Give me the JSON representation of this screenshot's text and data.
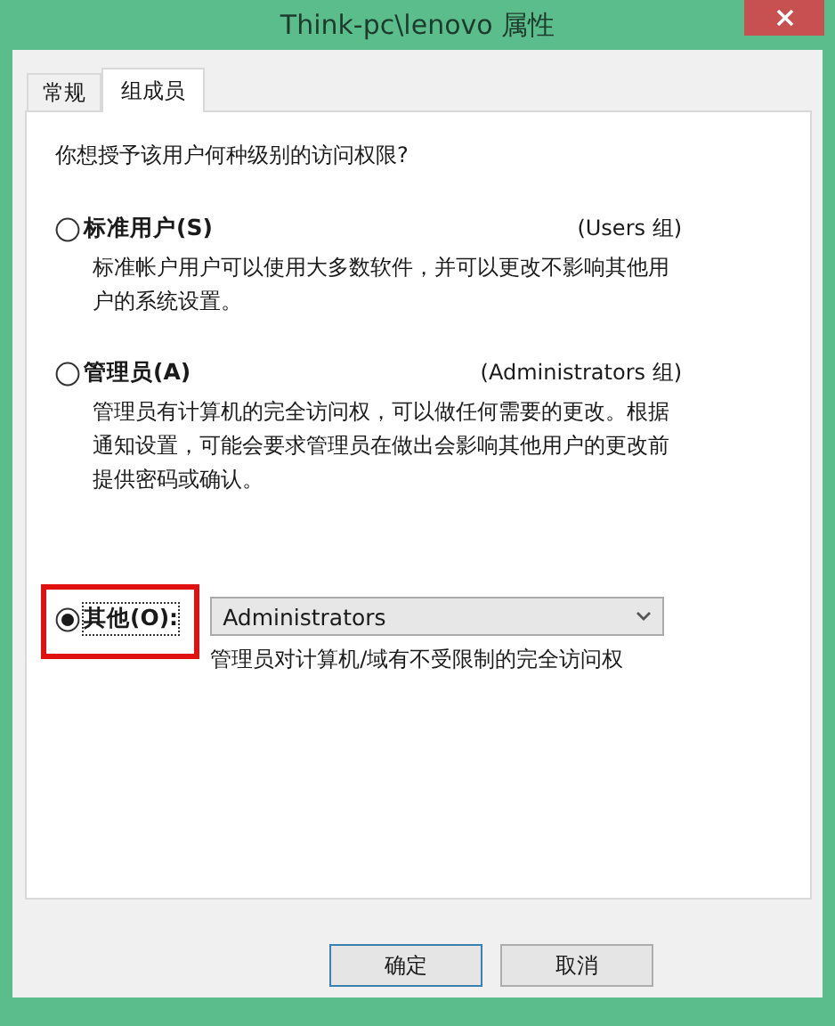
{
  "window": {
    "title": "Think-pc\\lenovo 属性"
  },
  "tabs": [
    {
      "label": "常规",
      "selected": false
    },
    {
      "label": "组成员",
      "selected": true
    }
  ],
  "question": "你想授予该用户何种级别的访问权限?",
  "options": [
    {
      "kind": "preset",
      "label": "标准用户(S)",
      "group": "(Users 组)",
      "description": "标准帐户用户可以使用大多数软件，并可以更改不影响其他用户的系统设置。",
      "selected": false,
      "highlighted": false
    },
    {
      "kind": "preset",
      "label": "管理员(A)",
      "group": "(Administrators 组)",
      "description": "管理员有计算机的完全访问权，可以做任何需要的更改。根据通知设置，可能会要求管理员在做出会影响其他用户的更改前提供密码或确认。",
      "selected": false,
      "highlighted": false
    },
    {
      "kind": "custom",
      "label": "其他(O):",
      "dropdown": {
        "value": "Administrators"
      },
      "description": "管理员对计算机/域有不受限制的完全访问权",
      "selected": true,
      "highlighted": true
    }
  ],
  "buttons": [
    {
      "label": "确定",
      "default": true
    },
    {
      "label": "取消",
      "default": false
    }
  ]
}
